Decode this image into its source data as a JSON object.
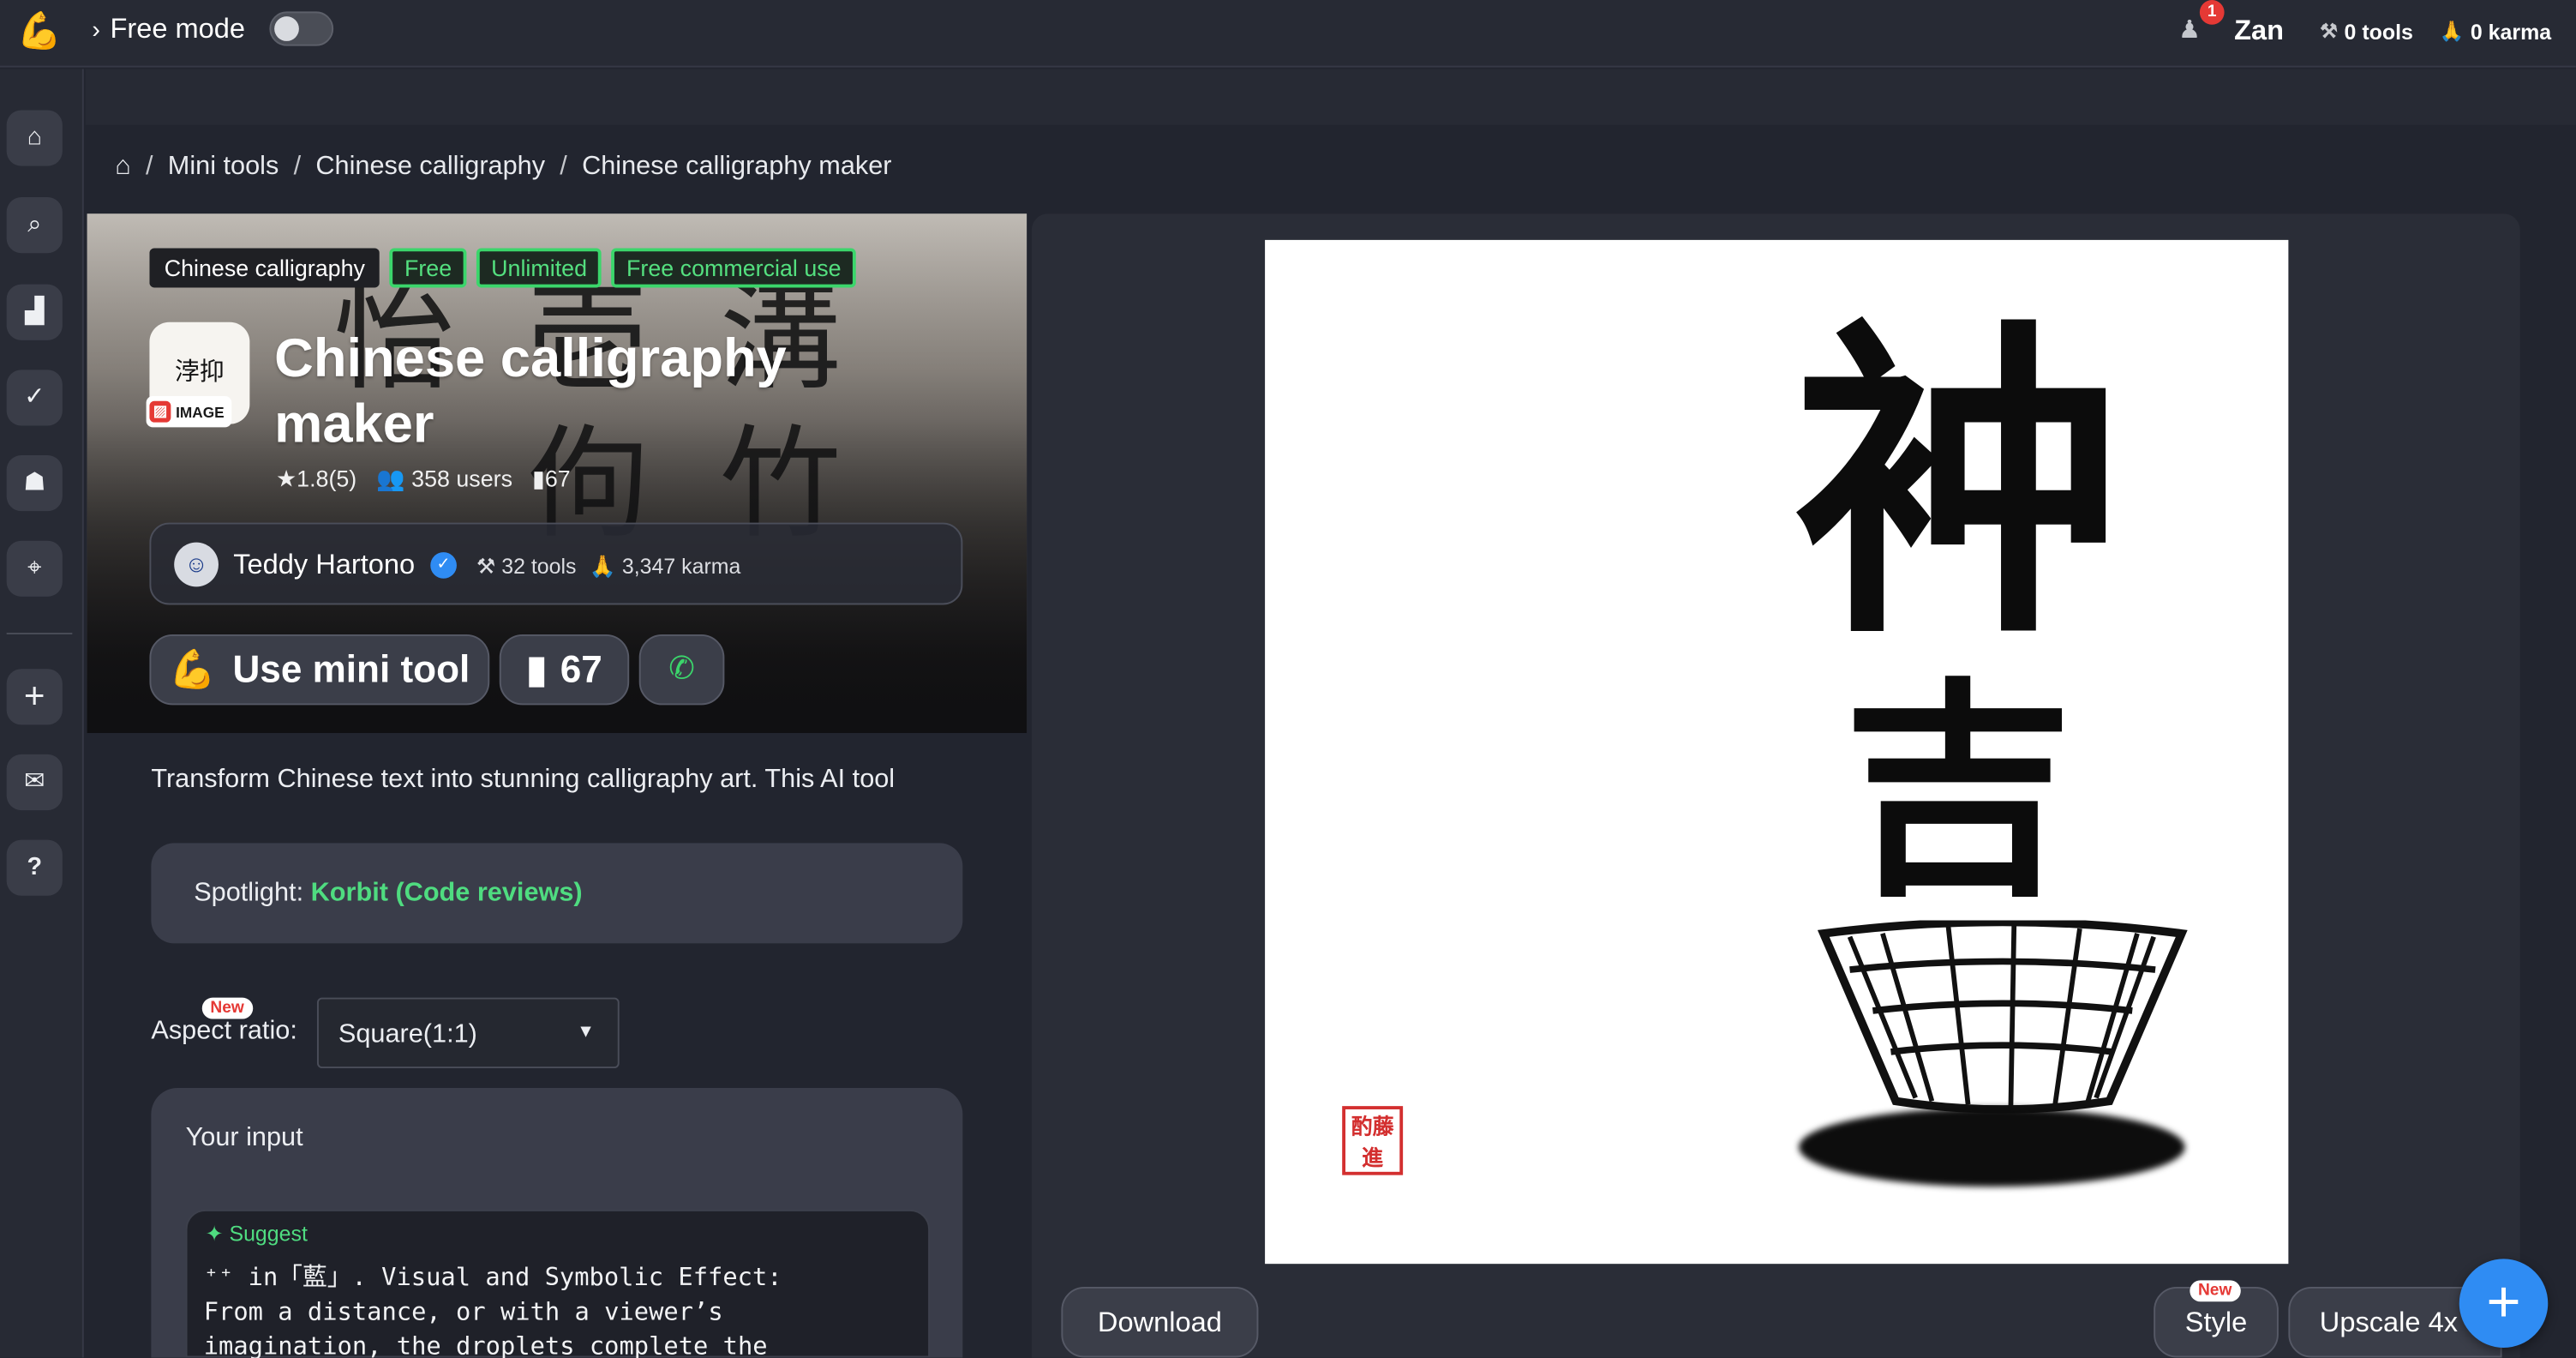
{
  "topbar": {
    "logo_icon": "muscle-arm-icon",
    "mode_label": "Free mode",
    "mode_enabled": false,
    "notifications": "1",
    "user_name": "Zan",
    "tools": "0 tools",
    "karma": "0 karma"
  },
  "sidebar": {
    "items": [
      {
        "name": "home",
        "icon": "⌂"
      },
      {
        "name": "search",
        "icon": "⌕"
      },
      {
        "name": "leaderboard",
        "icon": "▟"
      },
      {
        "name": "tasks",
        "icon": "✓"
      },
      {
        "name": "ghost",
        "icon": "☗"
      },
      {
        "name": "location",
        "icon": "⌖"
      },
      {
        "name": "add",
        "icon": "+"
      },
      {
        "name": "mail",
        "icon": "✉"
      },
      {
        "name": "help",
        "icon": "?"
      }
    ]
  },
  "breadcrumb": {
    "items": [
      "Mini tools",
      "Chinese calligraphy",
      "Chinese calligraphy maker"
    ]
  },
  "hero": {
    "tags": [
      "Chinese calligraphy",
      "Free",
      "Unlimited",
      "Free commercial use"
    ],
    "badge": "IMAGE",
    "title": "Chinese calligraphy maker",
    "rating": "1.8(5)",
    "users": "358 users",
    "bookmarks": "67",
    "author": {
      "name": "Teddy Hartono",
      "tools": "32 tools",
      "karma": "3,347 karma"
    },
    "use_button": "Use mini tool",
    "bookmark_count": "67"
  },
  "description": "Transform Chinese text into stunning calligraphy art. This AI tool",
  "spotlight": {
    "label": "Spotlight:",
    "link": "Korbit (Code reviews)"
  },
  "aspect_ratio": {
    "badge": "New",
    "label": "Aspect ratio:",
    "value": "Square(1:1)"
  },
  "input": {
    "label": "Your input",
    "suggest": "Suggest",
    "text": "⁺⁺ in「藍」. Visual and Symbolic Effect:\nFrom a distance, or with a viewer’s\nimagination, the droplets complete the"
  },
  "result": {
    "download": "Download",
    "style_badge": "New",
    "style": "Style",
    "upscale": "Upscale 4x"
  },
  "colors": {
    "accent_green": "#4fdc80",
    "fab_blue": "#2f8cf3",
    "badge_red": "#e53935"
  }
}
